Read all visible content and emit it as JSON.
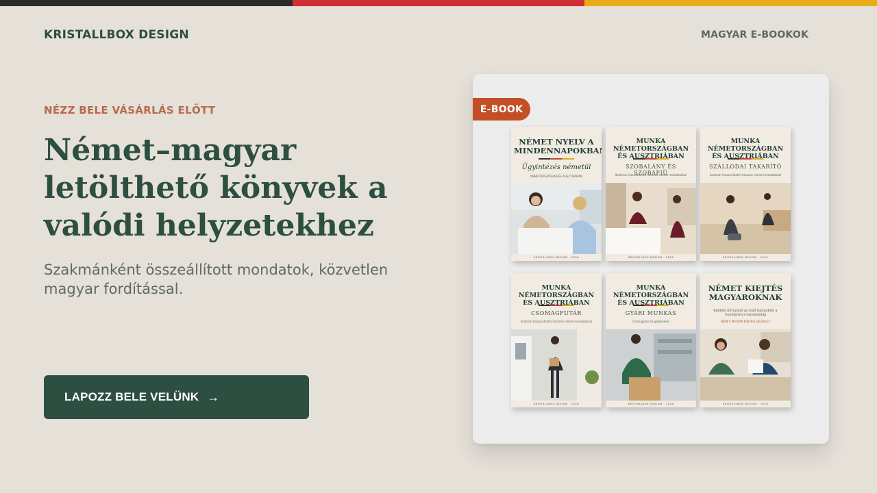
{
  "flag_colors": [
    "#2a2a2a",
    "#d02f35",
    "#e6ad19"
  ],
  "brand": "KRISTALLBOX DESIGN",
  "nav": {
    "link": "MAGYAR E-BOOKOK"
  },
  "hero": {
    "eyebrow": "NÉZZ BELE VÁSÁRLÁS ELŐTT",
    "headline": "Német–magyar letölthető könyvek a valódi helyzetekhez",
    "subtext": "Szakmánként összeállított mondatok, közvetlen magyar fordítással.",
    "cta_label": "LAPOZZ BELE VELÜNK",
    "cta_icon": "arrow-right-icon"
  },
  "preview": {
    "badge": "E-BOOK",
    "covers": [
      {
        "title": "Német nyelv a mindennapokban",
        "subtitle": "Ügyintézés németül",
        "tagline": "NÉMETORSZÁGBAN ÉS AUSZTRIÁBAN",
        "footer": "KRISTALLBOX DESIGN · 2026"
      },
      {
        "title": "Munka Németországban és Ausztriában",
        "subtitle": "Szobalány és szobafiú",
        "tagline": "Szakmai (használható) hasznos német mondatokkal",
        "footer": "KRISTALLBOX DESIGN · 2026"
      },
      {
        "title": "Munka Németországban és Ausztriában",
        "subtitle": "Szállodai takarító",
        "tagline": "Szakmai (használható) hasznos német mondatokkal",
        "footer": "KRISTALLBOX DESIGN · 2026"
      },
      {
        "title": "Munka Németországban és Ausztriában",
        "subtitle": "Csomagfutár",
        "tagline": "Szakmai (használható) hasznos német mondatokkal",
        "footer": "KRISTALLBOX DESIGN · 2026"
      },
      {
        "title": "Munka Németországban és Ausztriában",
        "subtitle": "Gyári munkás",
        "tagline": "Csomagolás és gépkezelés",
        "footer": "KRISTALLBOX DESIGN · 2026"
      },
      {
        "title": "Német kiejtés magyaroknak",
        "subtitle": "Kiejtési útmutató az első hangoktól a munkahelyi mondatokig",
        "tagline": "NÉMET–MAGYAR KIEJTÉSI SEGÉDLET",
        "footer": "KRISTALLBOX DESIGN · 2026"
      }
    ]
  }
}
